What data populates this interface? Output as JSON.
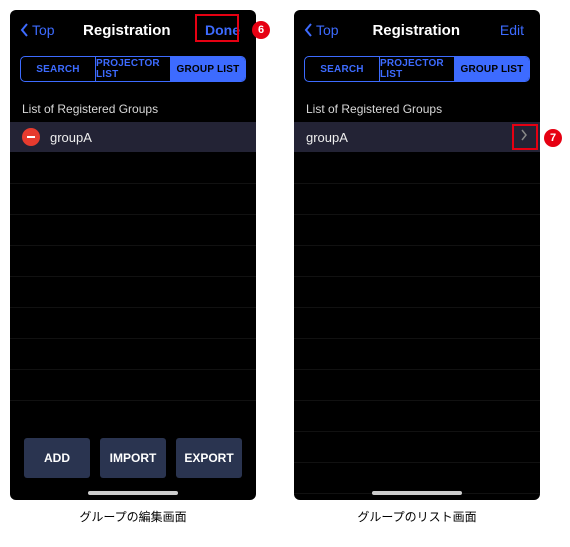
{
  "left": {
    "nav": {
      "back": "Top",
      "title": "Registration",
      "action": "Done"
    },
    "segments": [
      "SEARCH",
      "PROJECTOR LIST",
      "GROUP LIST"
    ],
    "section_label": "List of Registered Groups",
    "group_name": "groupA",
    "buttons": {
      "add": "ADD",
      "import": "IMPORT",
      "export": "EXPORT"
    },
    "caption": "グループの編集画面"
  },
  "right": {
    "nav": {
      "back": "Top",
      "title": "Registration",
      "action": "Edit"
    },
    "segments": [
      "SEARCH",
      "PROJECTOR LIST",
      "GROUP LIST"
    ],
    "section_label": "List of Registered Groups",
    "group_name": "groupA",
    "caption": "グループのリスト画面"
  },
  "callouts": {
    "six": "6",
    "seven": "7"
  }
}
